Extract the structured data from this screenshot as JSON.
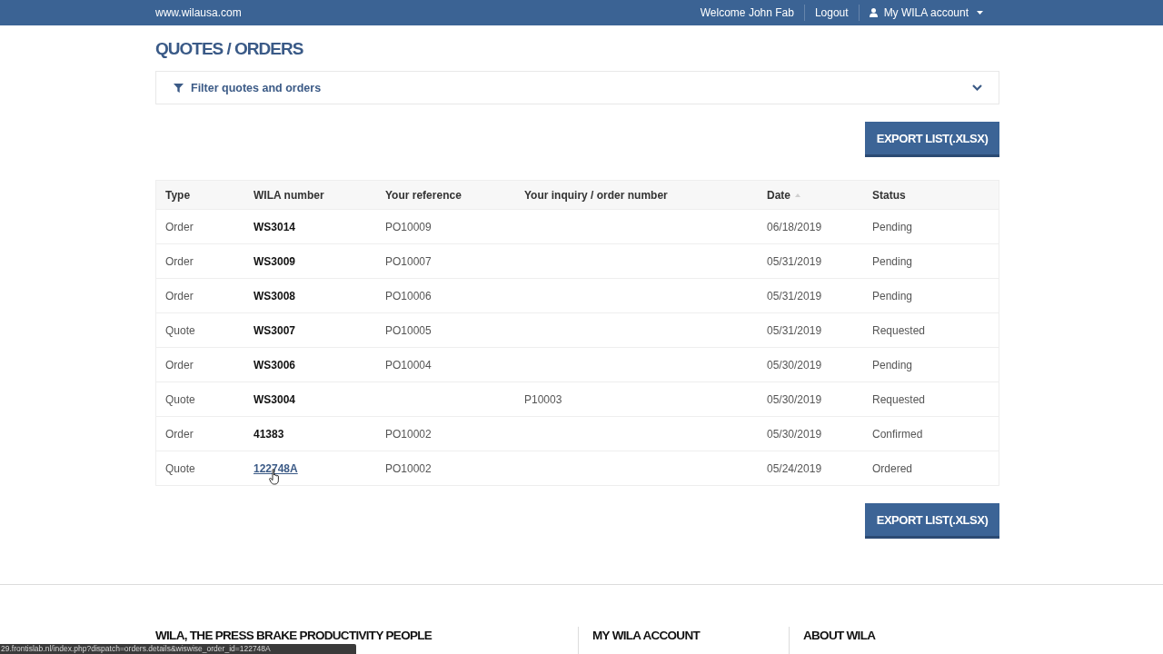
{
  "top_bar": {
    "site_link": "www.wilausa.com",
    "welcome": "Welcome John Fab",
    "logout": "Logout",
    "account_menu": "My WILA account"
  },
  "page_title": "QUOTES / ORDERS",
  "filter_panel": {
    "label": "Filter quotes and orders",
    "expanded": false
  },
  "export_button_top": {
    "label": "EXPORT LIST(.XLSX)"
  },
  "table": {
    "columns": [
      {
        "label": "Type",
        "sorted": false
      },
      {
        "label": "WILA number",
        "sorted": false
      },
      {
        "label": "Your reference",
        "sorted": false
      },
      {
        "label": "Your inquiry / order number",
        "sorted": false
      },
      {
        "label": "Date",
        "sorted": true
      },
      {
        "label": "Status",
        "sorted": false
      }
    ],
    "rows": [
      {
        "type": "Order",
        "wila_number": "WS3014",
        "your_reference": "PO10009",
        "date": "06/18/2019",
        "status": "Pending",
        "hovered": false
      },
      {
        "type": "Order",
        "wila_number": "WS3009",
        "your_reference": "PO10007",
        "date": "05/31/2019",
        "status": "Pending",
        "hovered": false
      },
      {
        "type": "Order",
        "wila_number": "WS3008",
        "your_reference": "PO10006",
        "date": "05/31/2019",
        "status": "Pending",
        "hovered": false
      },
      {
        "type": "Quote",
        "wila_number": "WS3007",
        "your_reference": "PO10005",
        "date": "05/31/2019",
        "status": "Requested",
        "hovered": false
      },
      {
        "type": "Order",
        "wila_number": "WS3006",
        "your_reference": "PO10004",
        "date": "05/30/2019",
        "status": "Pending",
        "hovered": false
      },
      {
        "type": "Quote",
        "wila_number": "WS3004",
        "inquiry_order_number": "P10003",
        "date": "05/30/2019",
        "status": "Requested",
        "hovered": false
      },
      {
        "type": "Order",
        "wila_number": "41383",
        "your_reference": "PO10002",
        "date": "05/30/2019",
        "status": "Confirmed",
        "hovered": false
      },
      {
        "type": "Quote",
        "wila_number": "122748A",
        "your_reference": "PO10002",
        "date": "05/24/2019",
        "status": "Ordered",
        "hovered": true
      }
    ]
  },
  "export_button_bottom": {
    "label": "EXPORT LIST(.XLSX)"
  },
  "footer": {
    "columns": [
      {
        "heading": "WILA, THE PRESS BRAKE PRODUCTIVITY PEOPLE"
      },
      {
        "heading": "MY WILA ACCOUNT"
      },
      {
        "heading": "ABOUT WILA"
      }
    ]
  },
  "status_bar": {
    "url": "29.frontislab.nl/index.php?dispatch=orders.details&wiswise_order_id=122748A"
  }
}
